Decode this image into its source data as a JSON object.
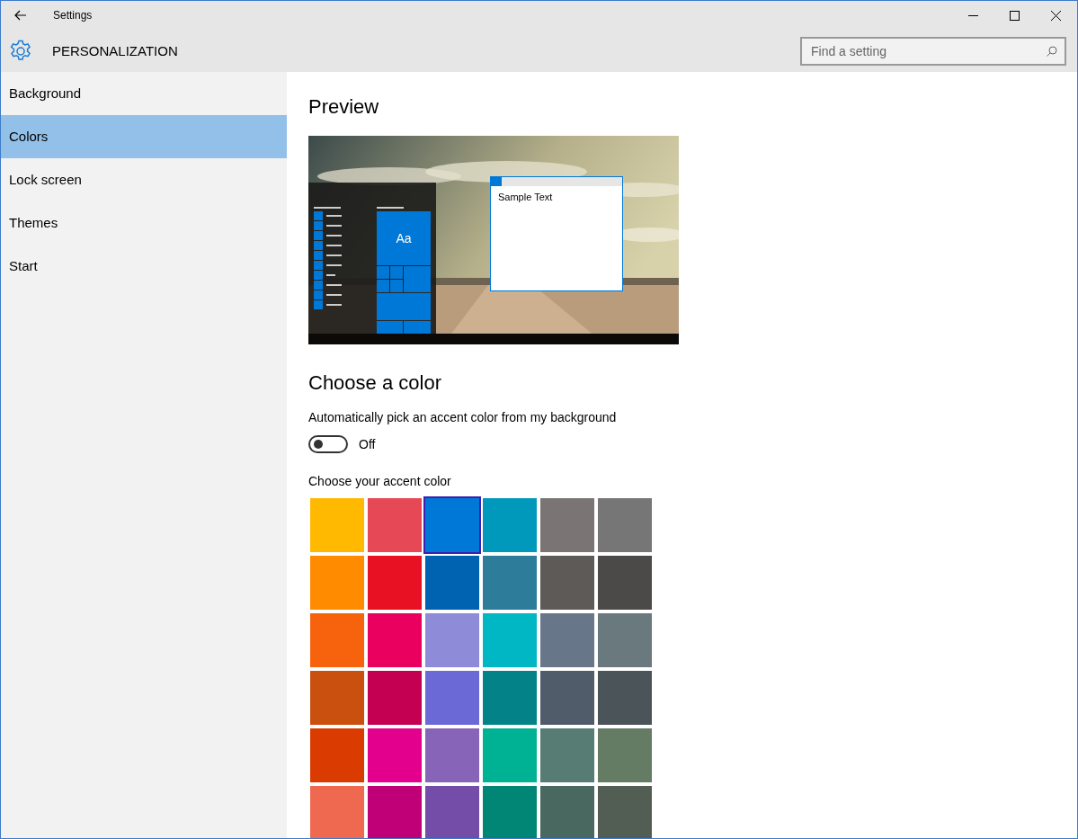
{
  "window": {
    "title": "Settings"
  },
  "header": {
    "title": "PERSONALIZATION",
    "search": {
      "placeholder": "Find a setting"
    }
  },
  "sidebar": {
    "items": [
      {
        "label": "Background",
        "selected": false
      },
      {
        "label": "Colors",
        "selected": true
      },
      {
        "label": "Lock screen",
        "selected": false
      },
      {
        "label": "Themes",
        "selected": false
      },
      {
        "label": "Start",
        "selected": false
      }
    ]
  },
  "preview": {
    "heading": "Preview",
    "tile_label": "Aa",
    "sample_text": "Sample Text"
  },
  "choose_color": {
    "heading": "Choose a color",
    "auto_label": "Automatically pick an accent color from my background",
    "auto_toggle": {
      "on": false,
      "state_label": "Off"
    },
    "accent_label": "Choose your accent color",
    "swatches": [
      {
        "color": "#ffb900",
        "selected": false
      },
      {
        "color": "#e74856",
        "selected": false
      },
      {
        "color": "#0078d7",
        "selected": true
      },
      {
        "color": "#0099bc",
        "selected": false
      },
      {
        "color": "#7a7574",
        "selected": false
      },
      {
        "color": "#767676",
        "selected": false
      },
      {
        "color": "#ff8c00",
        "selected": false
      },
      {
        "color": "#e81123",
        "selected": false
      },
      {
        "color": "#0063b1",
        "selected": false
      },
      {
        "color": "#2d7d9a",
        "selected": false
      },
      {
        "color": "#5d5a58",
        "selected": false
      },
      {
        "color": "#4c4a48",
        "selected": false
      },
      {
        "color": "#f7630c",
        "selected": false
      },
      {
        "color": "#ea005e",
        "selected": false
      },
      {
        "color": "#8e8cd8",
        "selected": false
      },
      {
        "color": "#00b7c3",
        "selected": false
      },
      {
        "color": "#68768a",
        "selected": false
      },
      {
        "color": "#69797e",
        "selected": false
      },
      {
        "color": "#ca5010",
        "selected": false
      },
      {
        "color": "#c30052",
        "selected": false
      },
      {
        "color": "#6b69d6",
        "selected": false
      },
      {
        "color": "#038387",
        "selected": false
      },
      {
        "color": "#515c6b",
        "selected": false
      },
      {
        "color": "#4a5459",
        "selected": false
      },
      {
        "color": "#da3b01",
        "selected": false
      },
      {
        "color": "#e3008c",
        "selected": false
      },
      {
        "color": "#8764b8",
        "selected": false
      },
      {
        "color": "#00b294",
        "selected": false
      },
      {
        "color": "#567c73",
        "selected": false
      },
      {
        "color": "#647c64",
        "selected": false
      },
      {
        "color": "#ef6950",
        "selected": false
      },
      {
        "color": "#bf0077",
        "selected": false
      },
      {
        "color": "#744da9",
        "selected": false
      },
      {
        "color": "#018574",
        "selected": false
      },
      {
        "color": "#486860",
        "selected": false
      },
      {
        "color": "#525e54",
        "selected": false
      }
    ]
  }
}
